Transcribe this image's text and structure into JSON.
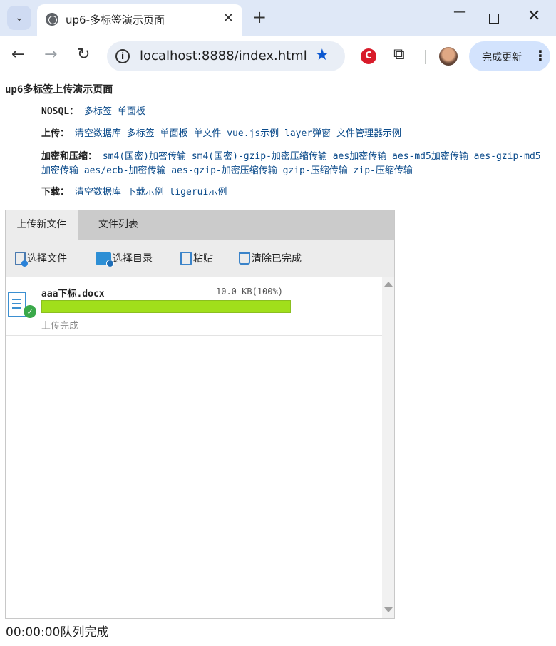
{
  "browser": {
    "tab_title": "up6-多标签演示页面",
    "url": "localhost:8888/index.html",
    "update_label": "完成更新"
  },
  "page": {
    "title": "up6多标签上传演示页面",
    "nosql": {
      "label": "NOSQL：",
      "links": [
        "多标签",
        "单面板"
      ]
    },
    "upload": {
      "label": "上传：",
      "links": [
        "清空数据库",
        "多标签",
        "单面板",
        "单文件",
        "vue.js示例",
        "layer弹窗",
        "文件管理器示例"
      ]
    },
    "crypto": {
      "label": "加密和压缩：",
      "links": [
        "sm4(国密)加密传输",
        "sm4(国密)-gzip-加密压缩传输",
        "aes加密传输",
        "aes-md5加密传输",
        "aes-gzip-md5加密传输",
        "aes/ecb-加密传输",
        "aes-gzip-加密压缩传输",
        "gzip-压缩传输",
        "zip-压缩传输"
      ]
    },
    "download": {
      "label": "下载：",
      "links": [
        "清空数据库",
        "下载示例",
        "ligerui示例"
      ]
    }
  },
  "uploader": {
    "tabs": [
      "上传新文件",
      "文件列表"
    ],
    "buttons": {
      "select_file": "选择文件",
      "select_dir": "选择目录",
      "paste": "粘贴",
      "clear_done": "清除已完成"
    },
    "files": [
      {
        "name": "aaa下标.docx",
        "size": "10.0 KB(100%)",
        "progress": 1.0,
        "status": "上传完成"
      }
    ],
    "progress_color": "#a1df1b"
  },
  "queue_status": "00:00:00队列完成"
}
